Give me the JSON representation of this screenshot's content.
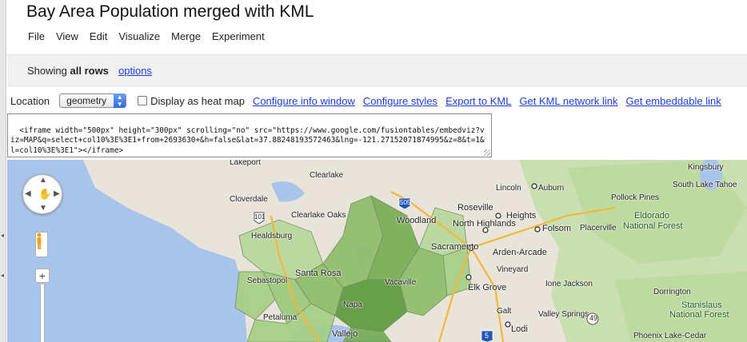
{
  "title": "Bay Area Population merged with KML",
  "menu": [
    "File",
    "View",
    "Edit",
    "Visualize",
    "Merge",
    "Experiment"
  ],
  "showing": {
    "prefix": "Showing",
    "bold": "all rows",
    "options_link": "options"
  },
  "toolbar": {
    "location_label": "Location",
    "location_value": "geometry",
    "heatmap_label": "Display as heat map",
    "links": [
      "Configure info window",
      "Configure styles",
      "Export to KML",
      "Get KML network link",
      "Get embeddable link"
    ]
  },
  "embed_code": "<iframe width=\"500px\" height=\"300px\" scrolling=\"no\" src=\"https://www.google.com/fusiontables/embedviz?viz=MAP&q=select+col10%3E%3E1+from+2693630+&h=false&lat=37.88248193572463&lng=-121.27152071874995&z=8&t=1&l=col10%3E%3E1\"></iframe>",
  "map": {
    "labels": {
      "lakeport": "Lakeport",
      "clearlake": "Clearlake",
      "cloverdale": "Cloverdale",
      "hwy101": "101",
      "clearlake_oaks": "Clearlake Oaks",
      "hwy505": "505",
      "lincoln": "Lincoln",
      "auburn": "Auburn",
      "kingsbury": "Kingsbury",
      "south_lake_tahoe": "South Lake Tahoe",
      "pollock_pines": "Pollock Pines",
      "roseville": "Roseville",
      "citrus_heights": "Heights",
      "woodland": "Woodland",
      "north_highlands": "North Highlands",
      "folsom": "Folsom",
      "placerville": "Placerville",
      "eldorado": "Eldorado",
      "eldorado_nf": "National Forest",
      "healdsburg": "Healdsburg",
      "sacramento": "Sacramento",
      "arden_arcade": "Arden-Arcade",
      "santa_rosa": "Santa Rosa",
      "vacaville": "Vacaville",
      "elk_grove": "Elk Grove",
      "vineyard": "Vineyard",
      "ione_jackson": "Ione Jackson",
      "sebastopol": "Sebastopol",
      "napa": "Napa",
      "dorrington": "Dorrington",
      "stanislaus": "Stanislaus",
      "stanislaus_nf": "National Forest",
      "petaluma": "Petaluma",
      "vallejo": "Vallejo",
      "lodi": "Lodi",
      "valley_springs": "Valley Springs",
      "galt": "Galt",
      "phoenix_lake": "Phoenix Lake-Cedar",
      "hwy49": "49",
      "hwy5": "5"
    }
  },
  "colors": {
    "link": "#1a3ee0",
    "water": "#a9c4ea",
    "land": "#e8e4da",
    "forest": "#c9dfb0",
    "region_light": "#b7d89a",
    "region_mid": "#8fbd6b",
    "region_dark": "#5e9a3e",
    "highway": "#f5b73a"
  }
}
